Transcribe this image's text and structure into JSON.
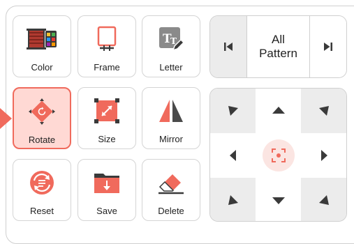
{
  "tiles": [
    {
      "key": "color",
      "label": "Color",
      "icon": "color-palette-icon"
    },
    {
      "key": "frame",
      "label": "Frame",
      "icon": "embroidery-frame-icon"
    },
    {
      "key": "letter",
      "label": "Letter",
      "icon": "letter-edit-icon"
    },
    {
      "key": "rotate",
      "label": "Rotate",
      "icon": "rotate-icon",
      "active": true
    },
    {
      "key": "size",
      "label": "Size",
      "icon": "resize-icon"
    },
    {
      "key": "mirror",
      "label": "Mirror",
      "icon": "mirror-icon"
    },
    {
      "key": "reset",
      "label": "Reset",
      "icon": "reset-icon"
    },
    {
      "key": "save",
      "label": "Save",
      "icon": "save-folder-icon"
    },
    {
      "key": "delete",
      "label": "Delete",
      "icon": "eraser-icon"
    }
  ],
  "pattern_selector": {
    "line1": "All",
    "line2": "Pattern",
    "prev_icon": "skip-previous-icon",
    "next_icon": "skip-next-icon"
  },
  "colors": {
    "accent": "#f06a5c",
    "active_bg": "#ffd9d4",
    "dark_icon": "#3a3a3a",
    "corner_bg": "#ececec"
  }
}
